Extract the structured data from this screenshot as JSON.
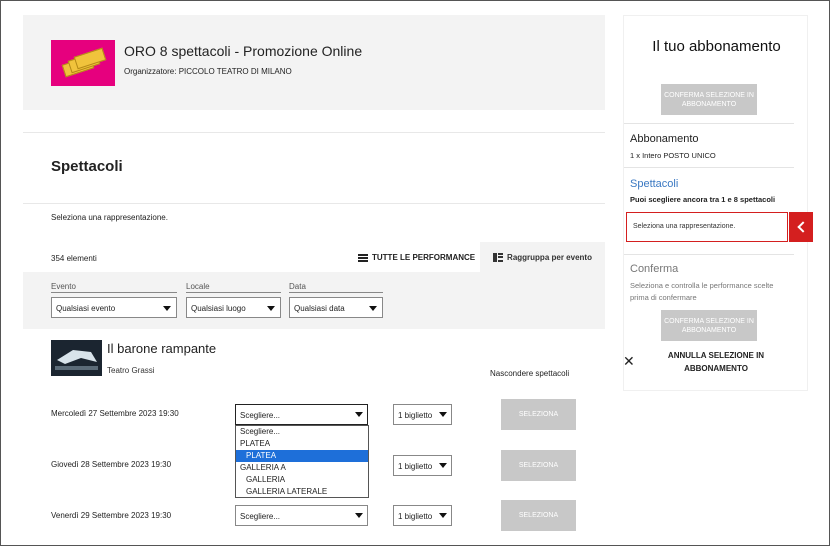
{
  "header": {
    "title": "ORO 8 spettacoli - Promozione Online",
    "organizer": "Organizzatore: PICCOLO TEATRO DI MILANO"
  },
  "section": {
    "title": "Spettacoli",
    "hint": "Seleziona una rappresentazione."
  },
  "toolbar": {
    "count": "354 elementi",
    "tab_all": "TUTTE LE PERFORMANCE",
    "tab_group": "Raggruppa per evento"
  },
  "filters": [
    {
      "label": "Evento",
      "value": "Qualsiasi evento"
    },
    {
      "label": "Locale",
      "value": "Qualsiasi luogo"
    },
    {
      "label": "Data",
      "value": "Qualsiasi data"
    }
  ],
  "event": {
    "title": "Il barone rampante",
    "venue": "Teatro Grassi",
    "hide_label": "Nascondere spettacoli"
  },
  "performances": [
    {
      "date": "Mercoledì 27 Settembre 2023 19:30",
      "seat": "Scegliere...",
      "qty": "1 biglietto",
      "button": "SELEZIONA"
    },
    {
      "date": "Giovedì 28 Settembre 2023 19:30",
      "seat": "Scegliere...",
      "qty": "1 biglietto",
      "button": "SELEZIONA"
    },
    {
      "date": "Venerdì 29 Settembre 2023 19:30",
      "seat": "Scegliere...",
      "qty": "1 biglietto",
      "button": "SELEZIONA"
    }
  ],
  "dropdown_options": [
    "Scegliere...",
    "PLATEA",
    "PLATEA",
    "GALLERIA A",
    "GALLERIA",
    "GALLERIA LATERALE"
  ],
  "sidebar": {
    "title": "Il tuo abbonamento",
    "confirm_button": "CONFERMA SELEZIONE IN ABBONAMENTO",
    "abbonamento_heading": "Abbonamento",
    "abbonamento_detail": "1 x Intero POSTO UNICO",
    "spettacoli_heading": "Spettacoli",
    "spettacoli_detail": "Puoi scegliere ancora tra 1 e 8 spettacoli",
    "spettacoli_box": "Seleziona una rappresentazione.",
    "conferma_heading": "Conferma",
    "conferma_detail": "Seleziona e controlla le performance scelte prima di confermare",
    "confirm_button_2": "CONFERMA SELEZIONE IN ABBONAMENTO",
    "cancel_label": "ANNULLA SELEZIONE IN ABBONAMENTO"
  },
  "colors": {
    "accent_red": "#d41f1f",
    "link_blue": "#3a78c2",
    "highlight_blue": "#1e6fd9",
    "disabled_gray": "#c8c8c8"
  }
}
